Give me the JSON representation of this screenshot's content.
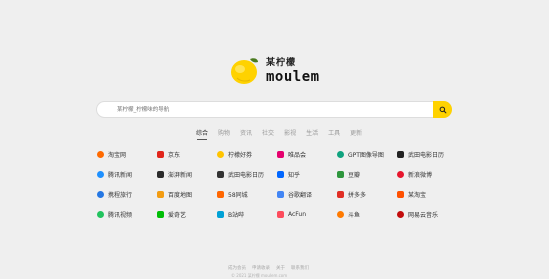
{
  "logo": {
    "cn": "某柠檬",
    "en": "moulem",
    "lemon_color": "#ffd200"
  },
  "search": {
    "placeholder": "某柠檬_柠檬味的导航",
    "button_color": "#ffd200",
    "icon": "search-icon"
  },
  "tabs": [
    {
      "label": "综合",
      "active": true
    },
    {
      "label": "购物",
      "active": false
    },
    {
      "label": "资讯",
      "active": false
    },
    {
      "label": "社交",
      "active": false
    },
    {
      "label": "影视",
      "active": false
    },
    {
      "label": "生活",
      "active": false
    },
    {
      "label": "工具",
      "active": false
    },
    {
      "label": "更新",
      "active": false
    }
  ],
  "sites": [
    {
      "label": "淘宝网",
      "color": "#ff6a00",
      "icon": "taobao-icon",
      "round": true
    },
    {
      "label": "京东",
      "color": "#e1251b",
      "icon": "jd-icon",
      "round": false
    },
    {
      "label": "柠檬好券",
      "color": "#ffc400",
      "icon": "coupon-icon",
      "round": true
    },
    {
      "label": "唯品会",
      "color": "#e5006e",
      "icon": "vip-icon",
      "round": false
    },
    {
      "label": "GPT图像导图",
      "color": "#10a37f",
      "icon": "gpt-icon",
      "round": true
    },
    {
      "label": "武田电影日历",
      "color": "#222222",
      "icon": "calendar-icon",
      "round": false
    },
    {
      "label": "腾讯新闻",
      "color": "#1e90ff",
      "icon": "tencent-news-icon",
      "round": true
    },
    {
      "label": "澎湃新闻",
      "color": "#2b2b2b",
      "icon": "thepaper-icon",
      "round": false
    },
    {
      "label": "武田电影日历",
      "color": "#333333",
      "icon": "movie-calendar-icon",
      "round": false
    },
    {
      "label": "知乎",
      "color": "#0066ff",
      "icon": "zhihu-icon",
      "round": false
    },
    {
      "label": "豆瓣",
      "color": "#2e963d",
      "icon": "douban-icon",
      "round": false
    },
    {
      "label": "新浪微博",
      "color": "#e6162d",
      "icon": "weibo-icon",
      "round": true
    },
    {
      "label": "携程旅行",
      "color": "#2577e3",
      "icon": "ctrip-icon",
      "round": true
    },
    {
      "label": "百度地图",
      "color": "#f39c12",
      "icon": "baidu-map-icon",
      "round": false
    },
    {
      "label": "58同城",
      "color": "#ff6600",
      "icon": "58-icon",
      "round": false
    },
    {
      "label": "谷歌翻译",
      "color": "#4285f4",
      "icon": "google-translate-icon",
      "round": false
    },
    {
      "label": "拼多多",
      "color": "#e02e24",
      "icon": "pinduoduo-icon",
      "round": false
    },
    {
      "label": "某淘宝",
      "color": "#ff5000",
      "icon": "shop-icon",
      "round": false
    },
    {
      "label": "腾讯视频",
      "color": "#22c35e",
      "icon": "tencent-video-icon",
      "round": true
    },
    {
      "label": "爱奇艺",
      "color": "#00be06",
      "icon": "iqiyi-icon",
      "round": false
    },
    {
      "label": "B站哔",
      "color": "#00a1d6",
      "icon": "bilibili-icon",
      "round": false
    },
    {
      "label": "AcFun",
      "color": "#fd4c5d",
      "icon": "acfun-icon",
      "round": false
    },
    {
      "label": "斗鱼",
      "color": "#ff7a00",
      "icon": "douyu-icon",
      "round": true
    },
    {
      "label": "网易云音乐",
      "color": "#c20c0c",
      "icon": "netease-music-icon",
      "round": true
    }
  ],
  "footer": {
    "links": [
      "成为会员",
      "申请收录",
      "关于",
      "联系我们"
    ],
    "copyright": "© 2021 某柠檬 moulem.com"
  }
}
